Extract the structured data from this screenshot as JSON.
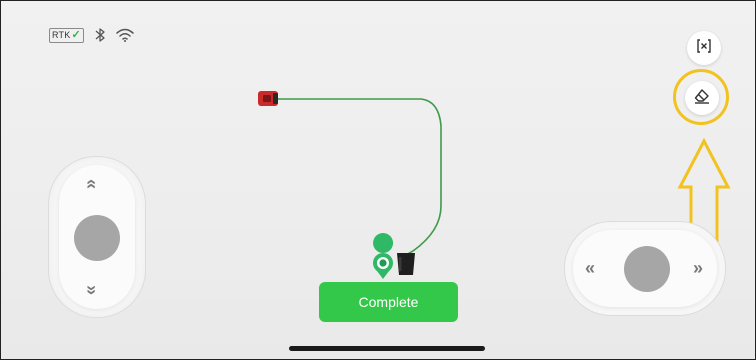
{
  "status_bar": {
    "rtk_label": "RTK",
    "rtk_check_glyph": "✓",
    "icons": [
      "rtk-icon",
      "bluetooth-icon",
      "wifi-icon"
    ]
  },
  "actions": {
    "complete_label": "Complete"
  },
  "right_toolbar": {
    "clear_icon": "clear-map-icon",
    "erase_icon": "eraser-icon"
  },
  "joysticks": {
    "left": {
      "up_glyph": "«",
      "down_glyph": "»"
    },
    "right": {
      "left_glyph": "«",
      "right_glyph": "»"
    }
  },
  "colors": {
    "accent_green": "#33c84a",
    "path_green": "#3f9a4a",
    "highlight_yellow": "#f2c21f",
    "mower_red": "#c92a2a",
    "knob_gray": "#a6a6a6"
  }
}
